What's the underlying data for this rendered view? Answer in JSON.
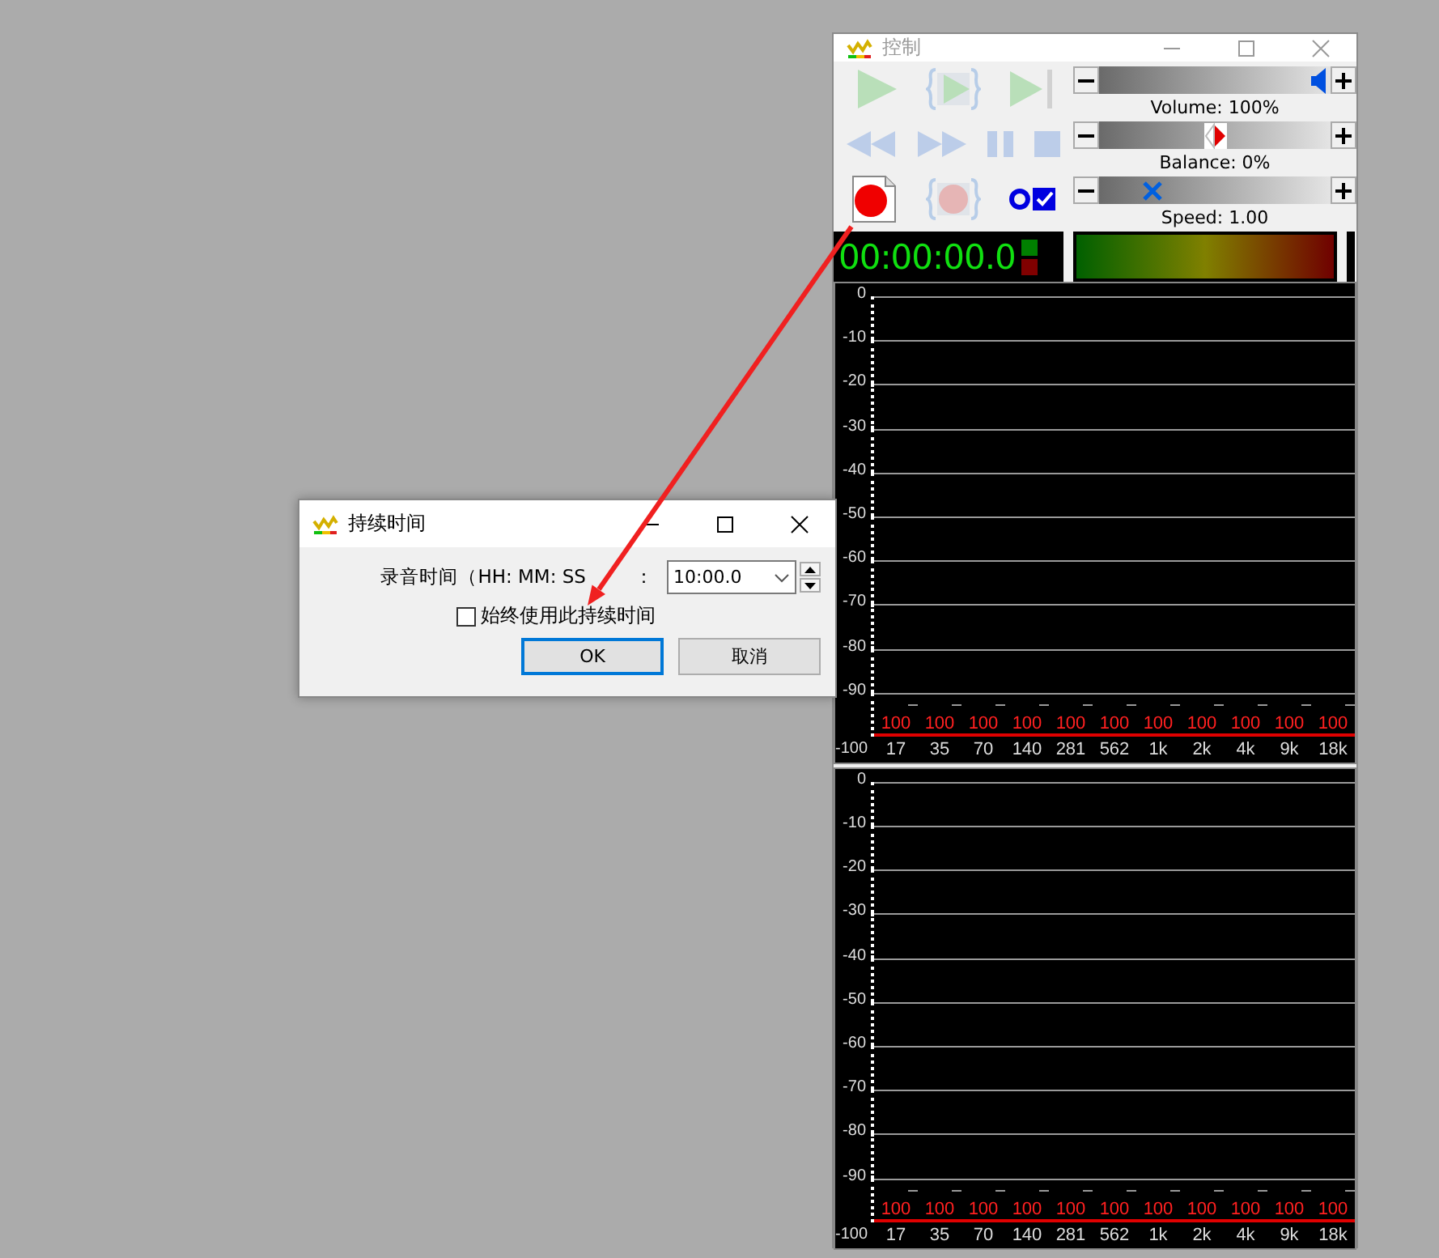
{
  "control_window": {
    "title": "控制",
    "transport_rows": [
      [
        {
          "kind": "play",
          "disabled": true
        },
        {
          "kind": "play-loop",
          "disabled": true
        },
        {
          "kind": "play-to-end",
          "disabled": true
        }
      ],
      [
        {
          "kind": "rewind",
          "disabled": true
        },
        {
          "kind": "fast-forward",
          "disabled": true
        },
        {
          "kind": "pause",
          "disabled": true
        },
        {
          "kind": "stop",
          "disabled": true
        }
      ],
      [
        {
          "kind": "record",
          "disabled": false
        },
        {
          "kind": "record-loop",
          "disabled": true
        },
        {
          "kind": "record-options",
          "disabled": false
        }
      ]
    ],
    "sliders": [
      {
        "kind": "volume",
        "label": "Volume: 100%",
        "level": 1
      },
      {
        "kind": "balance",
        "label": "Balance: 0%",
        "level": 0.5
      },
      {
        "kind": "speed",
        "label": "Speed: 1.00",
        "level": 0.2
      }
    ],
    "timer": {
      "time": "00:00:00.0",
      "indicators": [
        {
          "color": "#008000"
        },
        {
          "color": "#800000"
        }
      ]
    },
    "spectrum_panels": [
      {
        "y_labels": [
          "0",
          "-10",
          "-20",
          "-30",
          "-40",
          "-50",
          "-60",
          "-70",
          "-80",
          "-90",
          "-100"
        ],
        "bands": [
          {
            "label": "17",
            "reading": "100"
          },
          {
            "label": "35",
            "reading": "100"
          },
          {
            "label": "70",
            "reading": "100"
          },
          {
            "label": "140",
            "reading": "100"
          },
          {
            "label": "281",
            "reading": "100"
          },
          {
            "label": "562",
            "reading": "100"
          },
          {
            "label": "1k",
            "reading": "100"
          },
          {
            "label": "2k",
            "reading": "100"
          },
          {
            "label": "4k",
            "reading": "100"
          },
          {
            "label": "9k",
            "reading": "100"
          },
          {
            "label": "18k",
            "reading": "100"
          }
        ]
      },
      {
        "y_labels": [
          "0",
          "-10",
          "-20",
          "-30",
          "-40",
          "-50",
          "-60",
          "-70",
          "-80",
          "-90",
          "-100"
        ],
        "bands": [
          {
            "label": "17",
            "reading": "100"
          },
          {
            "label": "35",
            "reading": "100"
          },
          {
            "label": "70",
            "reading": "100"
          },
          {
            "label": "140",
            "reading": "100"
          },
          {
            "label": "281",
            "reading": "100"
          },
          {
            "label": "562",
            "reading": "100"
          },
          {
            "label": "1k",
            "reading": "100"
          },
          {
            "label": "2k",
            "reading": "100"
          },
          {
            "label": "4k",
            "reading": "100"
          },
          {
            "label": "9k",
            "reading": "100"
          },
          {
            "label": "18k",
            "reading": "100"
          }
        ]
      }
    ]
  },
  "dialog": {
    "title": "持续时间",
    "duration_label": "录音时间（HH: MM: SS",
    "duration_colon": "：",
    "duration_value": "10:00.0",
    "always_use": {
      "label": "始终使用此持续时间",
      "checked": false
    },
    "buttons": [
      {
        "label": "OK",
        "default": true
      },
      {
        "label": "取消",
        "default": false
      }
    ]
  }
}
